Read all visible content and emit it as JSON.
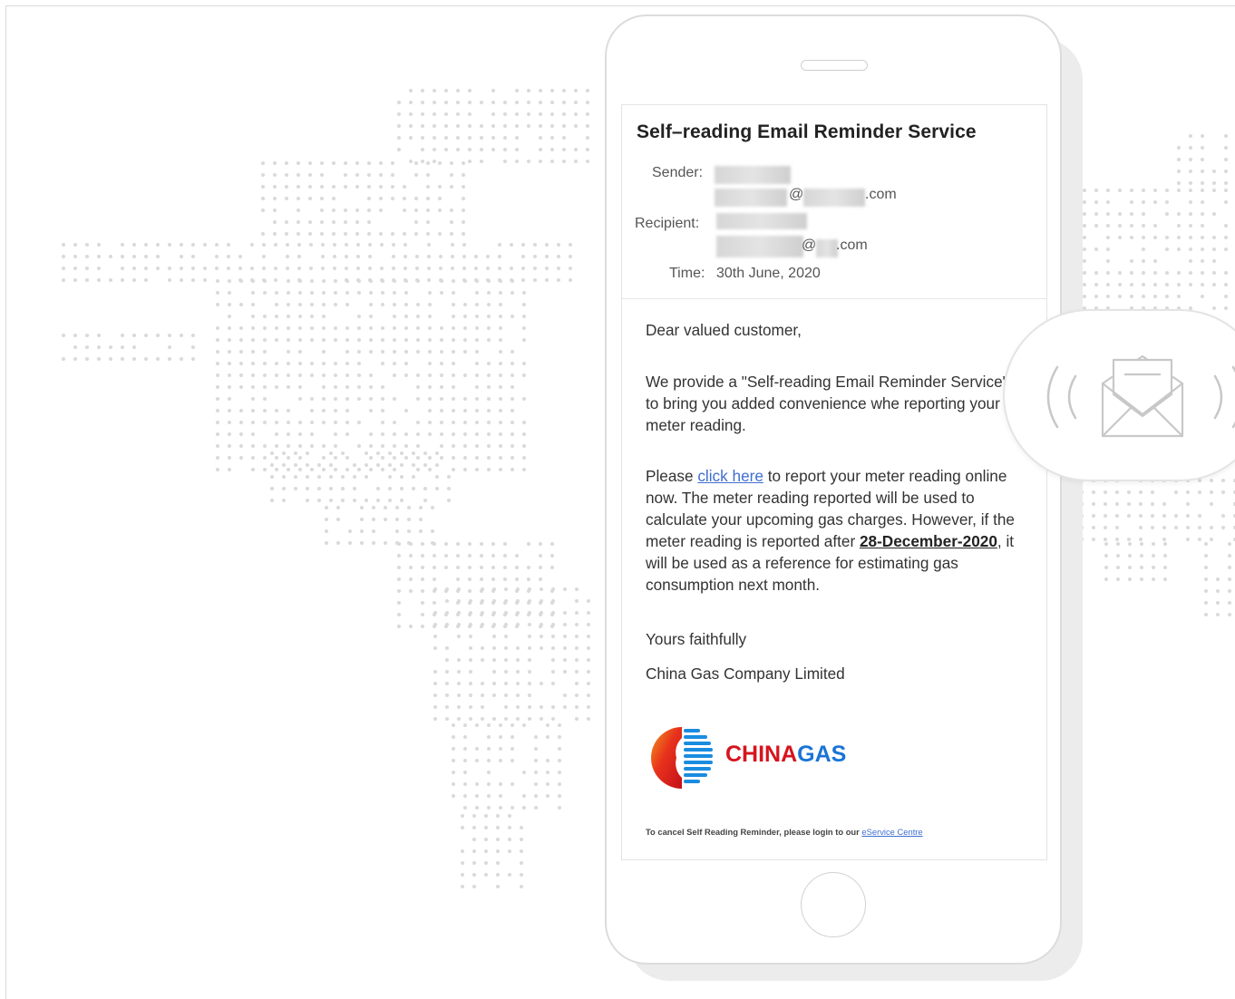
{
  "email": {
    "subject": "Self–reading Email Reminder Service",
    "sender_label": "Sender:",
    "sender_domain_suffix": ".com",
    "sender_at": "@",
    "recipient_label": "Recipient:",
    "recipient_at": "@",
    "recipient_domain_suffix": ".com",
    "time_label": "Time:",
    "time_value": "30th June, 2020",
    "greeting": "Dear valued customer,",
    "para1": "We provide a \"Self-reading Email Reminder Service\" to bring you added convenience whe reporting your meter reading.",
    "para2_prefix": "Please ",
    "para2_link": "click here",
    "para2_mid": " to report your meter reading online now. The meter reading reported will be used to calculate your upcoming gas charges. However, if the meter reading is reported after ",
    "para2_deadline": "28-December-2020",
    "para2_suffix": ", it will be used as a reference for estimating gas consumption next month.",
    "closing": "Yours faithfully",
    "signature": "China Gas Company Limited",
    "logo": {
      "part1": "CHINA",
      "part2": "GAS",
      "color1": "#d6141e",
      "color2": "#1a74d6"
    },
    "footer_text": "To cancel Self Reading Reminder, please login to our ",
    "footer_link": "eService Centre"
  },
  "colors": {
    "link": "#3f6fd0",
    "map_dot": "#dadada",
    "phone_border": "#dcdcdc"
  },
  "icons": {
    "notification": "envelope-signal-icon"
  }
}
